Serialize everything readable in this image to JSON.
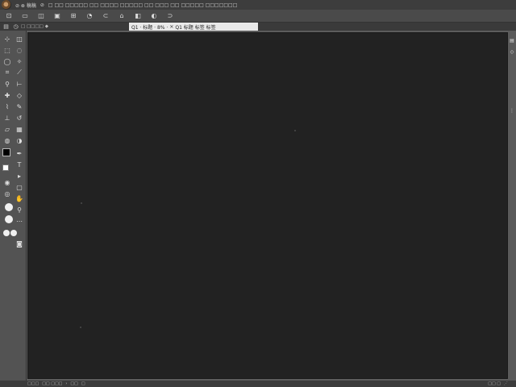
{
  "app": {
    "logo_name": "app-logo"
  },
  "menubar": {
    "items": [
      "⊘ ⊗ 稿稿",
      "⊘",
      "□ □□ □□□□□ □□ □□□□ □□□□□ □□ □□□ □□ □□□□□ □□□□□□□"
    ]
  },
  "optionsbar": {
    "icons": [
      "rectangle-select-icon",
      "move-icon",
      "lasso-icon",
      "layer-icon",
      "crop-icon",
      "eyedropper-icon",
      "brush-icon",
      "transform-icon",
      "heal-icon",
      "zoom-icon",
      "stamp-icon"
    ],
    "glyphs": [
      "⊡",
      "▭",
      "◫",
      "▣",
      "⊞",
      "◔",
      "⊂",
      "⌂",
      "◧",
      "◐",
      "⊃"
    ]
  },
  "tabsbar": {
    "left_texts": [
      "□ □□□□",
      "◆"
    ],
    "doc_tab_label": "Q1 · 标题 · 8% ·",
    "doc_tab_sub": "Q1 标题 标签 标签"
  },
  "status": {
    "zoom": "□□□",
    "doc_info": "□□ □□□",
    "mode": "□□",
    "right": "□□ □"
  },
  "colors": {
    "canvas": "#222222",
    "panel": "#535353",
    "menubar": "#3d3d3d"
  }
}
